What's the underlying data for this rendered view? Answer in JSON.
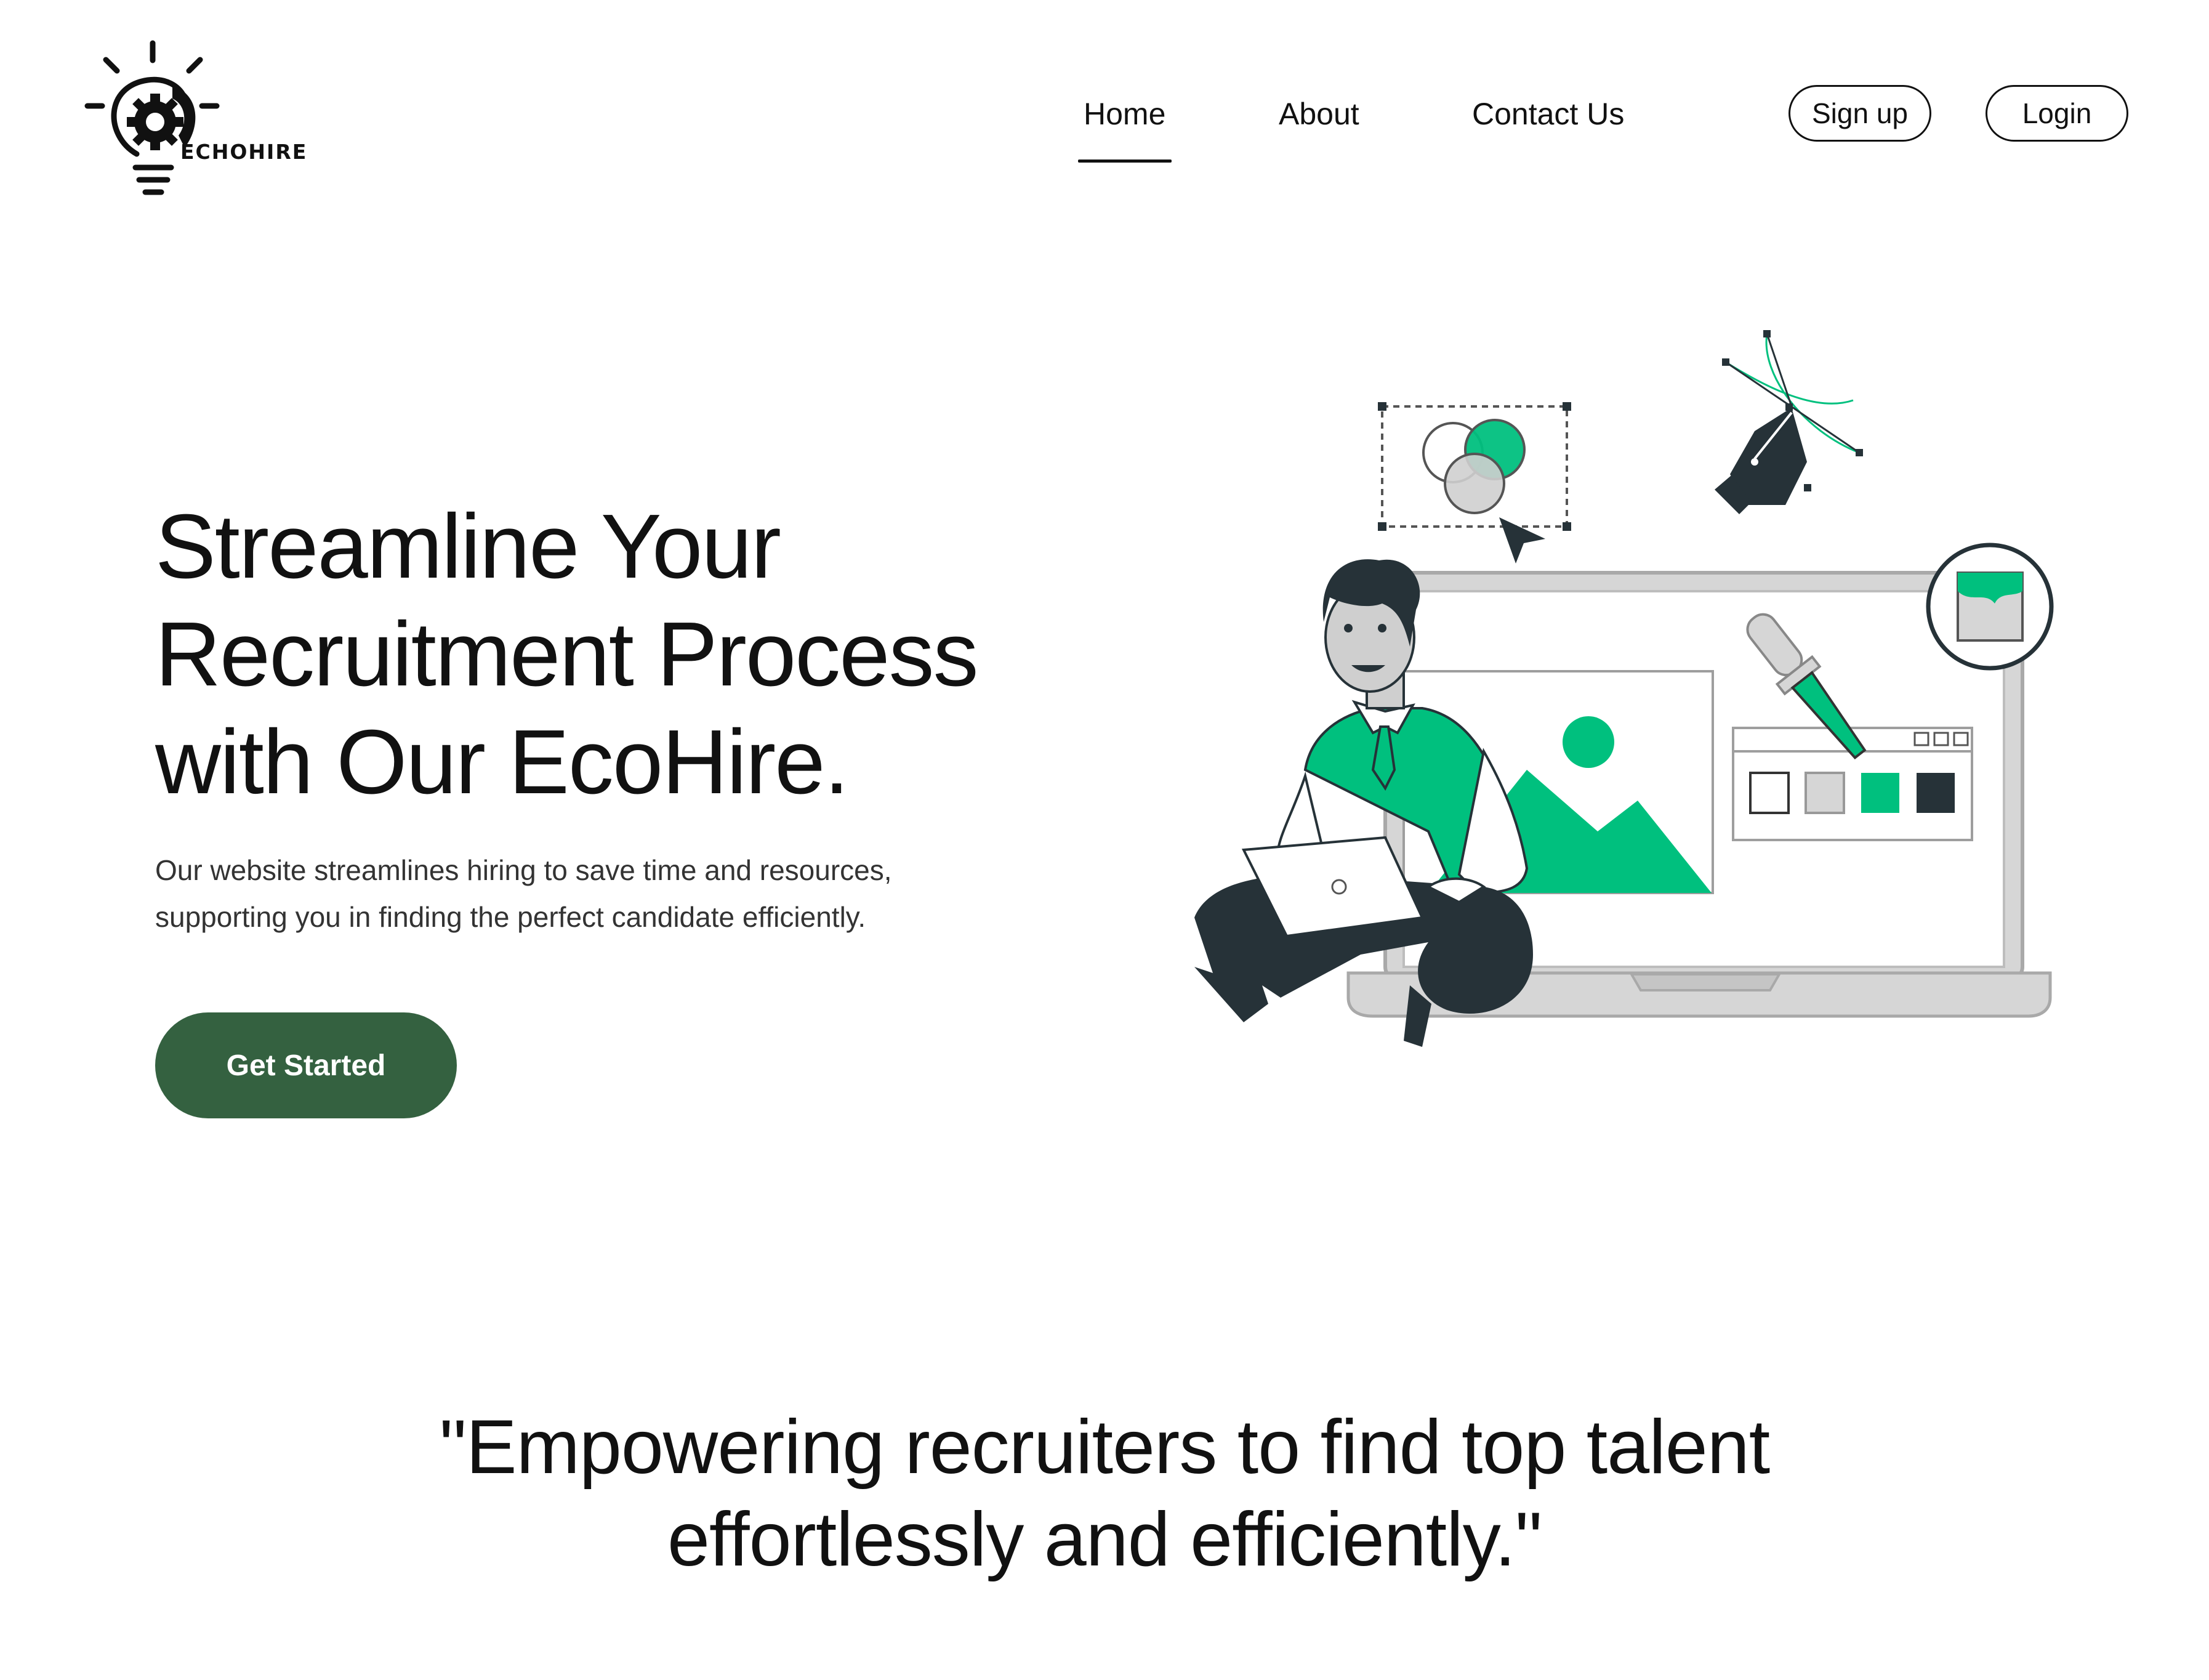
{
  "brand": {
    "logo_text": "ECHOHIRE"
  },
  "nav": {
    "links": [
      "Home",
      "About",
      "Contact Us"
    ],
    "active": "Home",
    "signup_label": "Sign up",
    "login_label": "Login"
  },
  "hero": {
    "title_lines": [
      "Streamline Your",
      "Recruitment Process",
      "with Our EcoHire."
    ],
    "description_lines": [
      "Our website streamlines hiring to save time and resources,",
      "supporting you in finding the perfect candidate efficiently."
    ],
    "cta_label": "Get Started"
  },
  "quote": {
    "lines": [
      "\"Empowering recruiters to find top talent",
      "effortlessly and efficiently.\""
    ]
  },
  "colors": {
    "accent_green": "#00C07E",
    "button_green": "#346140",
    "dark": "#263238",
    "text": "#111111"
  },
  "icons": [
    "lightbulb-gear-logo-icon",
    "pen-tool-icon",
    "cursor-icon",
    "paint-bucket-icon",
    "eyedropper-icon",
    "image-icon"
  ]
}
